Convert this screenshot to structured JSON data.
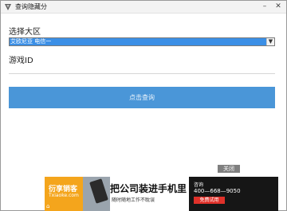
{
  "window": {
    "title": "查询隐藏分",
    "minimize_symbol": "–",
    "close_symbol": "✕"
  },
  "form": {
    "server_label": "选择大区",
    "server_selected": "艾欧尼亚 电信一",
    "dropdown_icon": "chevron-down-icon",
    "game_id_label": "游戏ID",
    "game_id_value": "",
    "query_button": "点击查询"
  },
  "ad_close_label": "关闭",
  "ad": {
    "brand_title": "衍享销客",
    "brand_sub": "Txiaoke.com",
    "home_icon": "home-icon",
    "headline": "把公司装进手机里",
    "subline": "随时随地工作不耽误",
    "consult": "咨询",
    "phone": "400—668—9050",
    "cta": "免费试用"
  },
  "colors": {
    "accent_button": "#4a96d8",
    "selection": "#3b8fe6",
    "ad_orange": "#f4a51c",
    "ad_red": "#e0312a"
  }
}
